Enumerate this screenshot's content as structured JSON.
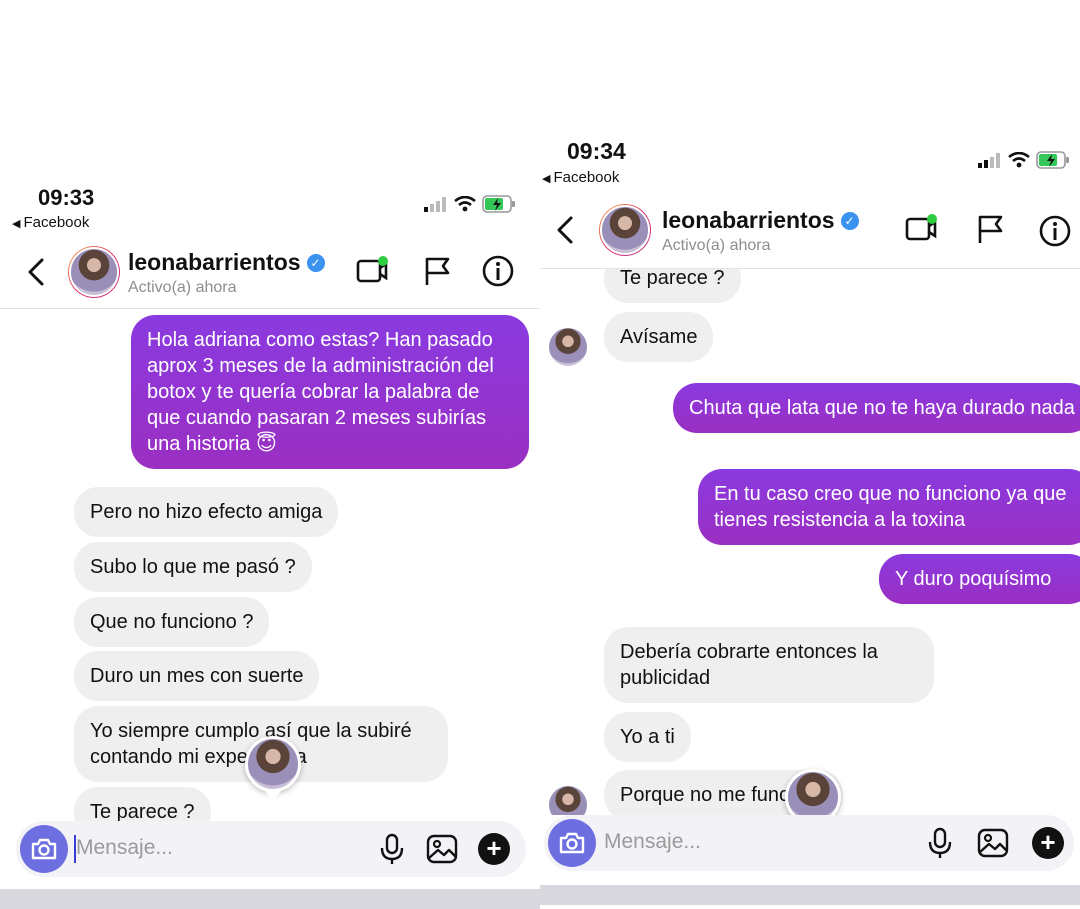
{
  "colors": {
    "outgoing_bubble": "#8e35d4",
    "incoming_bubble": "#efefef",
    "verified_badge": "#3b93f0",
    "camera_button": "#6d6ee0",
    "active_dot": "#2ecc40"
  },
  "left": {
    "status_bar": {
      "time": "09:33",
      "back_app": "Facebook"
    },
    "header": {
      "username": "leonabarrientos",
      "activity": "Activo(a) ahora"
    },
    "messages": [
      {
        "from": "me",
        "text": "Hola adriana como estas? Han pasado aprox 3 meses de la administración del botox y te quería cobrar la palabra de que cuando pasaran 2 meses subirías una historia 😇"
      },
      {
        "from": "them",
        "text": "Pero no hizo efecto amiga"
      },
      {
        "from": "them",
        "text": "Subo lo que me pasó ?"
      },
      {
        "from": "them",
        "text": "Que no funciono ?"
      },
      {
        "from": "them",
        "text": "Duro un mes con suerte"
      },
      {
        "from": "them",
        "text": "Yo siempre cumplo así que la subiré contando mi experiencia"
      },
      {
        "from": "them",
        "text": "Te parece ?"
      }
    ],
    "composer": {
      "placeholder": "Mensaje..."
    }
  },
  "right": {
    "status_bar": {
      "time": "09:34",
      "back_app": "Facebook"
    },
    "header": {
      "username": "leonabarrientos",
      "activity": "Activo(a) ahora"
    },
    "messages": [
      {
        "from": "them",
        "text": "Te parece ?"
      },
      {
        "from": "them",
        "text": "Avísame"
      },
      {
        "from": "me",
        "text": "Chuta que lata que no te haya durado nada"
      },
      {
        "from": "me",
        "text": "En tu caso creo que no funciono ya que tienes resistencia a la toxina"
      },
      {
        "from": "me",
        "text": "Y duro poquísimo"
      },
      {
        "from": "them",
        "text": "Debería cobrarte entonces la publicidad"
      },
      {
        "from": "them",
        "text": "Yo a ti"
      },
      {
        "from": "them",
        "text": "Porque no me funciono"
      }
    ],
    "composer": {
      "placeholder": "Mensaje..."
    }
  }
}
